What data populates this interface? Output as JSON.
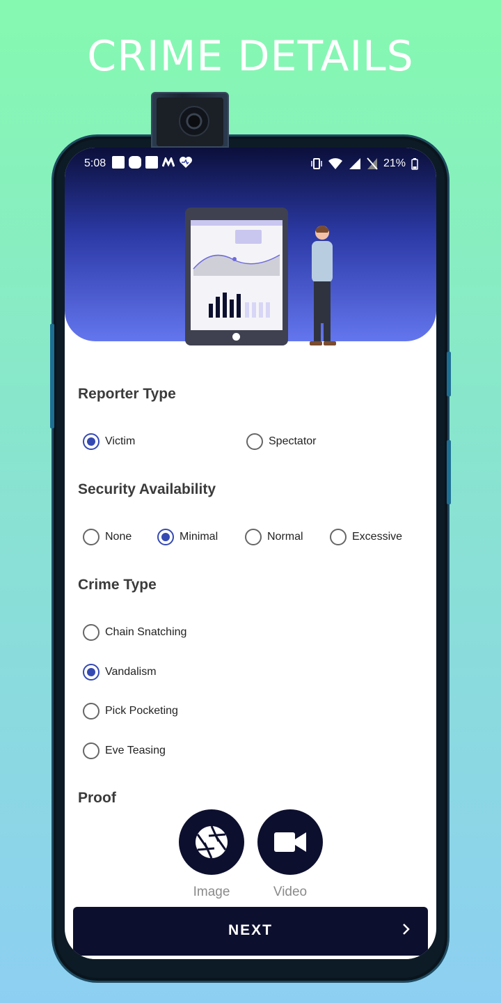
{
  "promo": {
    "title": "CRIME DETAILS"
  },
  "status_bar": {
    "time": "5:08",
    "battery": "21%"
  },
  "reporter_type": {
    "title": "Reporter Type",
    "options": [
      {
        "label": "Victim",
        "selected": true
      },
      {
        "label": "Spectator",
        "selected": false
      }
    ]
  },
  "security": {
    "title": "Security Availability",
    "options": [
      {
        "label": "None",
        "selected": false
      },
      {
        "label": "Minimal",
        "selected": true
      },
      {
        "label": "Normal",
        "selected": false
      },
      {
        "label": "Excessive",
        "selected": false
      }
    ]
  },
  "crime_type": {
    "title": "Crime Type",
    "options": [
      {
        "label": "Chain Snatching",
        "selected": false
      },
      {
        "label": "Vandalism",
        "selected": true
      },
      {
        "label": "Pick Pocketing",
        "selected": false
      },
      {
        "label": "Eve Teasing",
        "selected": false
      }
    ]
  },
  "proof": {
    "title": "Proof",
    "image_label": "Image",
    "video_label": "Video"
  },
  "next": {
    "label": "NEXT",
    "icon": "chevron-right-icon"
  },
  "colors": {
    "accent": "#3549b3",
    "dark": "#0d0f2e",
    "hero_top": "#0b0f3a",
    "hero_bottom": "#6476ee"
  }
}
